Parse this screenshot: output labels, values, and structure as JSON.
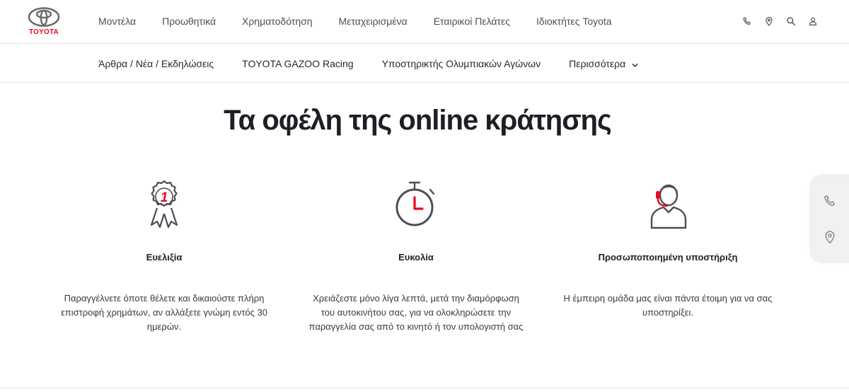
{
  "brand": {
    "name": "TOYOTA",
    "color": "#eb0a1e"
  },
  "main_nav": [
    {
      "label": "Μοντέλα"
    },
    {
      "label": "Προωθητικά"
    },
    {
      "label": "Χρηματοδότηση"
    },
    {
      "label": "Μεταχειρισμένα"
    },
    {
      "label": "Εταιρικοί Πελάτες"
    },
    {
      "label": "Ιδιοκτήτες Toyota"
    }
  ],
  "utility_icons": [
    "phone-icon",
    "location-pin-icon",
    "search-icon",
    "user-icon"
  ],
  "sub_nav": [
    {
      "label": "Άρθρα / Νέα / Εκδηλώσεις"
    },
    {
      "label": "TOYOTA GAZOO Racing"
    },
    {
      "label": "Υποστηρικτής Ολυμπιακών Αγώνων"
    },
    {
      "label": "Περισσότερα"
    }
  ],
  "section": {
    "title": "Τα οφέλη της online κράτησης"
  },
  "benefits": [
    {
      "icon": "award-ribbon-icon",
      "badge": "1",
      "title": "Ευελιξία",
      "text": "Παραγγέλνετε όποτε θέλετε και δικαιούστε πλήρη επιστροφή χρημάτων, αν αλλάξετε γνώμη εντός 30 ημερών."
    },
    {
      "icon": "stopwatch-icon",
      "title": "Ευκολία",
      "text": "Χρειάζεστε μόνο λίγα λεπτά, μετά την διαμόρφωση του αυτοκινήτου σας, για να ολοκληρώσετε την παραγγελία σας από το κινητό ή τον υπολογιστή σας"
    },
    {
      "icon": "support-agent-icon",
      "title": "Προσωποποιημένη υποστήριξη",
      "text": "Η έμπειρη ομάδα μας είναι πάντα έτοιμη για να σας υποστηρίξει."
    }
  ],
  "side_widget": [
    "phone-icon",
    "location-pin-icon"
  ],
  "colors": {
    "accent": "#eb0a1e",
    "text": "#282830",
    "icon": "#4d4d57"
  }
}
